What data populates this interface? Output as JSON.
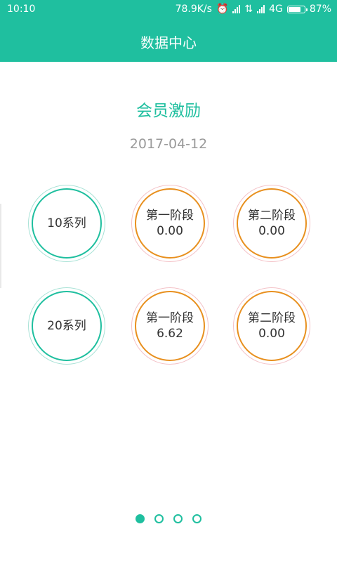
{
  "status_bar": {
    "time": "10:10",
    "net_speed": "78.9K/s",
    "network": "4G",
    "battery_pct": "87%",
    "battery_level": 0.87
  },
  "app_bar": {
    "title": "数据中心"
  },
  "section": {
    "title": "会员激励",
    "date": "2017-04-12"
  },
  "rows": [
    {
      "series_label": "10系列",
      "stages": [
        {
          "label": "第一阶段",
          "value": "0.00"
        },
        {
          "label": "第二阶段",
          "value": "0.00"
        }
      ]
    },
    {
      "series_label": "20系列",
      "stages": [
        {
          "label": "第一阶段",
          "value": "6.62"
        },
        {
          "label": "第二阶段",
          "value": "0.00"
        }
      ]
    }
  ],
  "pager": {
    "count": 4,
    "active_index": 0
  },
  "colors": {
    "primary": "#1fbf9f",
    "stage_ring": "#e8901f",
    "stage_halo": "#f4c2c7",
    "date_text": "#9a9a9a"
  }
}
